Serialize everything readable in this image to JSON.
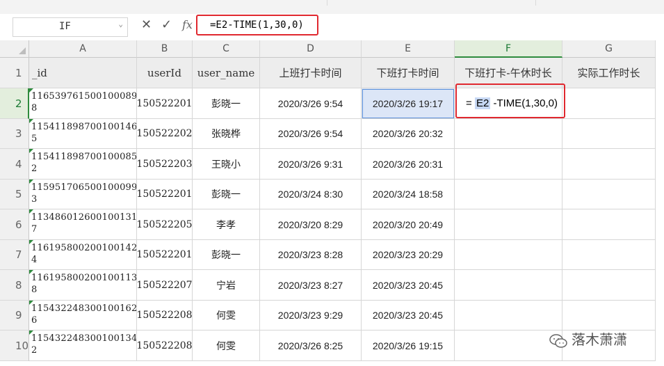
{
  "namebox": {
    "value": "IF"
  },
  "formula_bar": {
    "cancel": "✕",
    "confirm": "✓",
    "fx": "fx",
    "value": "=E2-TIME(1,30,0)"
  },
  "columns": [
    "A",
    "B",
    "C",
    "D",
    "E",
    "F",
    "G"
  ],
  "active_column": "F",
  "rows": [
    "1",
    "2",
    "3",
    "4",
    "5",
    "6",
    "7",
    "8",
    "9",
    "10"
  ],
  "headers": [
    "_id",
    "userId",
    "user_name",
    "上班打卡时间",
    "下班打卡时间",
    "下班打卡-午休时长",
    "实际工作时长"
  ],
  "data": [
    {
      "id": "1165397615001000898",
      "userId": "150522201",
      "name": "彭晓一",
      "in": "2020/3/26 9:54",
      "out": "2020/3/26 19:17"
    },
    {
      "id": "1154118987001001465",
      "userId": "150522202",
      "name": "张晓桦",
      "in": "2020/3/26 9:54",
      "out": "2020/3/26 20:32"
    },
    {
      "id": "1154118987001000852",
      "userId": "150522203",
      "name": "王晓小",
      "in": "2020/3/26 9:31",
      "out": "2020/3/26 20:31"
    },
    {
      "id": "1159517065001000993",
      "userId": "150522201",
      "name": "彭晓一",
      "in": "2020/3/24 8:30",
      "out": "2020/3/24 18:58"
    },
    {
      "id": "1134860126001001317",
      "userId": "150522205",
      "name": "李孝",
      "in": "2020/3/20 8:29",
      "out": "2020/3/20 20:49"
    },
    {
      "id": "1161958002001001424",
      "userId": "150522201",
      "name": "彭晓一",
      "in": "2020/3/23 8:28",
      "out": "2020/3/23 20:29"
    },
    {
      "id": "1161958002001001138",
      "userId": "150522207",
      "name": "宁岩",
      "in": "2020/3/23 8:27",
      "out": "2020/3/23 20:45"
    },
    {
      "id": "1154322483001001626",
      "userId": "150522208",
      "name": "何雯",
      "in": "2020/3/23 9:29",
      "out": "2020/3/23 20:45"
    },
    {
      "id": "1154322483001001342",
      "userId": "150522208",
      "name": "何雯",
      "in": "2020/3/26 8:25",
      "out": "2020/3/26 19:15"
    }
  ],
  "edit_cell": {
    "prefix": "= ",
    "ref": "E2",
    "rest": " -TIME(1,30,0)"
  },
  "watermark": "落木萧潇",
  "colors": {
    "accent_green": "#2e8b3d",
    "highlight_red": "#e0282f",
    "selection_blue": "#5b8fd9"
  }
}
